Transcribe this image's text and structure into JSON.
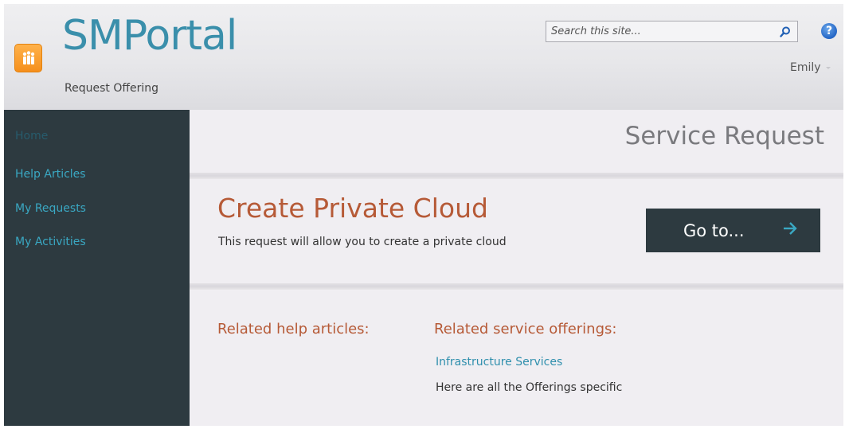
{
  "header": {
    "site_title": "SMPortal",
    "subtitle": "Request Offering",
    "search_placeholder": "Search this site...",
    "user_name": "Emily"
  },
  "sidebar": {
    "items": [
      {
        "label": "Home"
      },
      {
        "label": "Help Articles"
      },
      {
        "label": "My Requests"
      },
      {
        "label": "My Activities"
      }
    ]
  },
  "main": {
    "page_title": "Service Request",
    "offering_title": "Create Private Cloud",
    "offering_description": "This request will allow you to create a private cloud",
    "goto_label": "Go to...",
    "related_help_heading": "Related help articles:",
    "related_services_heading": "Related service offerings:",
    "related_services": [
      {
        "title": "Infrastructure Services",
        "description": "Here are all the Offerings specific"
      }
    ]
  },
  "colors": {
    "brand": "#3a8fab",
    "accent_orange": "#b65a37",
    "sidebar_bg": "#2d3a40",
    "link": "#3aa8c3"
  },
  "icons": {
    "logo": "people-app-icon",
    "search": "search-icon",
    "help": "help-icon",
    "goto_arrow": "arrow-right-icon"
  }
}
